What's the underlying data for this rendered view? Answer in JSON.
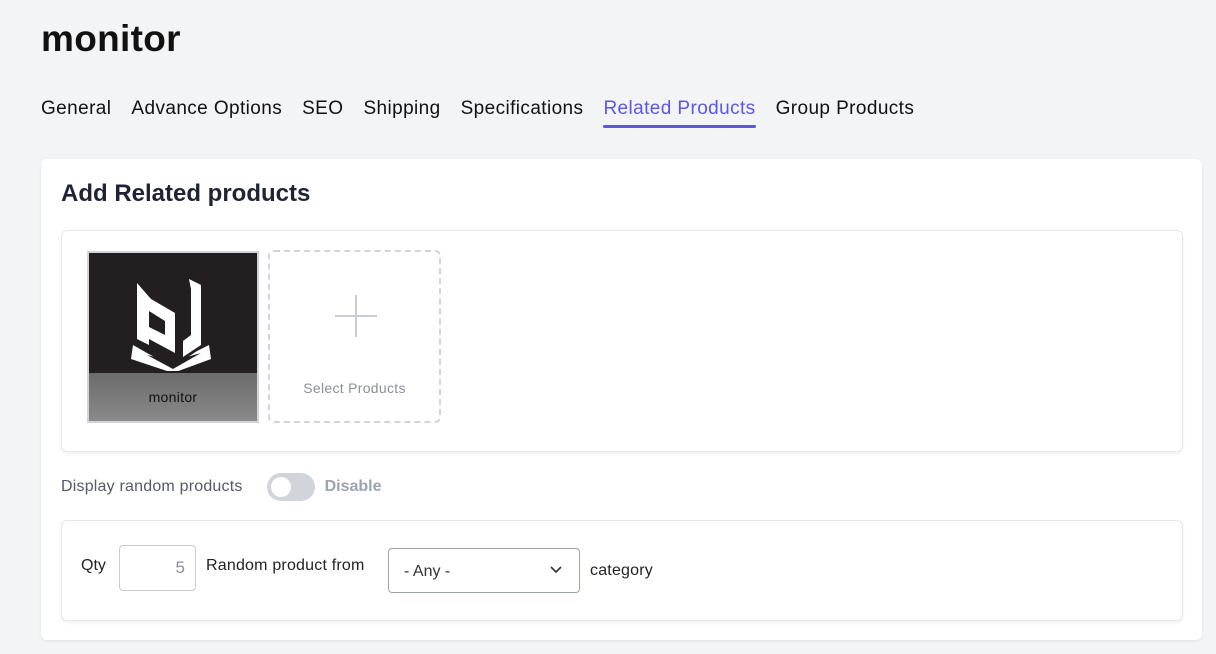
{
  "page": {
    "title": "monitor"
  },
  "tabs": [
    {
      "label": "General",
      "active": false
    },
    {
      "label": "Advance Options",
      "active": false
    },
    {
      "label": "SEO",
      "active": false
    },
    {
      "label": "Shipping",
      "active": false
    },
    {
      "label": "Specifications",
      "active": false
    },
    {
      "label": "Related Products",
      "active": true
    },
    {
      "label": "Group Products",
      "active": false
    }
  ],
  "related": {
    "heading": "Add Related products",
    "products": [
      {
        "name": "monitor",
        "image_icon": "pj-logo-icon"
      }
    ],
    "select_label": "Select Products"
  },
  "random": {
    "label": "Display random products",
    "toggle_on": false,
    "state_label": "Disable"
  },
  "qty": {
    "label": "Qty",
    "value": "5",
    "from_label": "Random product from",
    "category_value": "- Any -",
    "category_suffix": "category"
  },
  "colors": {
    "accent": "#5b57e6",
    "background": "#f3f4f6"
  }
}
